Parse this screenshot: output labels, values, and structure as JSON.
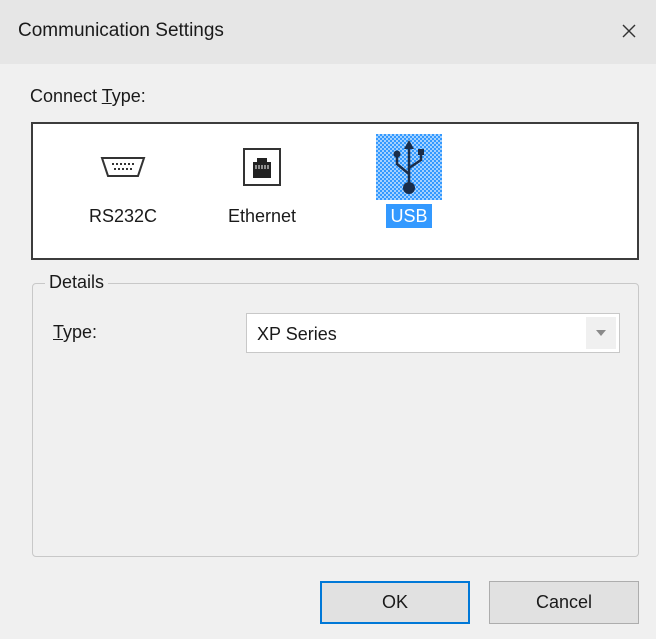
{
  "window": {
    "title": "Communication Settings",
    "close_glyph": "×"
  },
  "connect_type": {
    "label_prefix": "Connect ",
    "label_mnemonic": "T",
    "label_suffix": "ype:",
    "options": [
      {
        "label": "RS232C",
        "icon": "serial-port-icon",
        "selected": false
      },
      {
        "label": "Ethernet",
        "icon": "ethernet-port-icon",
        "selected": false
      },
      {
        "label": "USB",
        "icon": "usb-icon",
        "selected": true
      }
    ]
  },
  "details": {
    "legend": "Details",
    "type_label_mnemonic": "T",
    "type_label_suffix": "ype:",
    "type_value": "XP Series"
  },
  "buttons": {
    "ok": "OK",
    "cancel": "Cancel"
  },
  "colors": {
    "selection": "#3399ff",
    "default_button_border": "#0078d7",
    "background": "#f0f0f0"
  }
}
